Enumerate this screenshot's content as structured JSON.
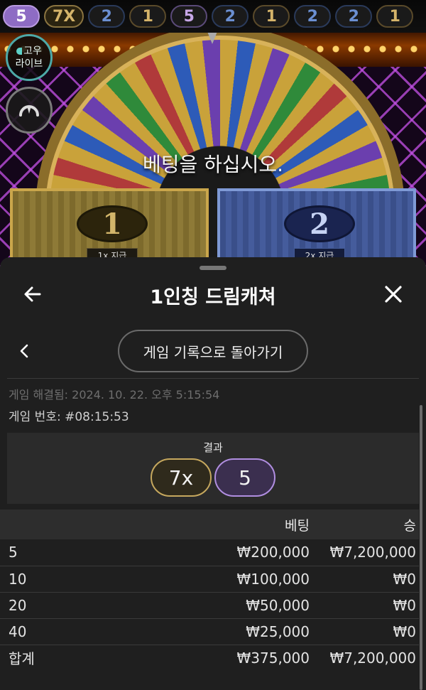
{
  "result_strip": [
    {
      "label": "5",
      "tone": "t5",
      "selected": true
    },
    {
      "label": "7X",
      "tone": "t7x",
      "selected": false
    },
    {
      "label": "2",
      "tone": "t2",
      "selected": false
    },
    {
      "label": "1",
      "tone": "t1",
      "selected": false
    },
    {
      "label": "5",
      "tone": "t5",
      "selected": false
    },
    {
      "label": "2",
      "tone": "t2",
      "selected": false
    },
    {
      "label": "1",
      "tone": "t1",
      "selected": false
    },
    {
      "label": "2",
      "tone": "t2",
      "selected": false
    },
    {
      "label": "2",
      "tone": "t2",
      "selected": false
    },
    {
      "label": "1",
      "tone": "t1",
      "selected": false
    }
  ],
  "live_button": {
    "line1": "고우",
    "line2": "라이브"
  },
  "bet_prompt": "베팅을 하십시오.",
  "tickets": [
    {
      "number": "1",
      "pay": "1x 지급"
    },
    {
      "number": "2",
      "pay": "2x 지급"
    }
  ],
  "sheet": {
    "title": "1인칭 드림캐쳐",
    "history_button": "게임 기록으로 돌아가기",
    "resolved": "게임 해결됨: 2024. 10. 22. 오후 5:15:54",
    "game_number": "게임 번호: #08:15:53",
    "result_label": "결과",
    "result_multiplier": "7x",
    "result_number": "5"
  },
  "table": {
    "headers": [
      "",
      "베팅",
      "승"
    ],
    "rows": [
      [
        "5",
        "₩200,000",
        "₩7,200,000"
      ],
      [
        "10",
        "₩100,000",
        "₩0"
      ],
      [
        "20",
        "₩50,000",
        "₩0"
      ],
      [
        "40",
        "₩25,000",
        "₩0"
      ]
    ],
    "total": [
      "합계",
      "₩375,000",
      "₩7,200,000"
    ]
  },
  "colors": {
    "accent_gold": "#c6a85e",
    "accent_purple": "#b08ee0",
    "live_teal": "#4da9a8"
  }
}
